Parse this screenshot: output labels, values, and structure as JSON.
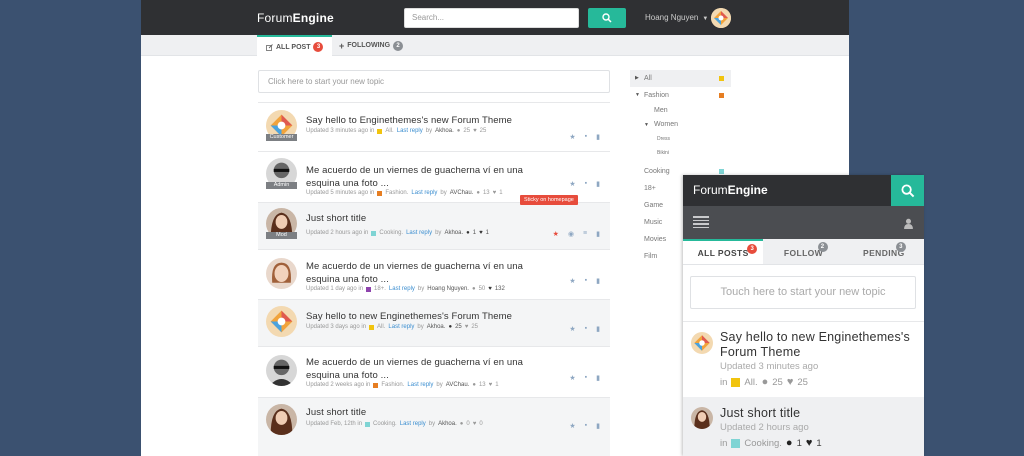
{
  "desktop": {
    "logo": {
      "a": "Forum",
      "b": "Engine"
    },
    "search_placeholder": "Search...",
    "user_name": "Hoang Nguyen",
    "tabs": [
      {
        "label": "ALL POST",
        "count": "3"
      },
      {
        "label": "FOLLOWING",
        "count": "2"
      }
    ],
    "new_topic_placeholder": "Click here to start your new topic",
    "tooltip": "Sticky on homepage",
    "threads": [
      {
        "title": "Say hello to Enginethemes's new Forum Theme",
        "role": "Customer",
        "updated": "Updated 3 minutes ago in",
        "category": "All.",
        "cat_color": "#f1c40f",
        "last_reply": "Last reply",
        "by": "by",
        "author": "Akhoa.",
        "comments": "25",
        "likes": "25"
      },
      {
        "title": "Me acuerdo de un viernes de guacherna ví en una esquina una foto ...",
        "role": "Admin",
        "updated": "Updated 5 minutes ago in",
        "category": "Fashion.",
        "cat_color": "#e67e22",
        "last_reply": "Last reply",
        "by": "by",
        "author": "AVChau.",
        "comments": "13",
        "likes": "1"
      },
      {
        "title": "Just short title",
        "role": "Mod",
        "updated": "Updated 2 hours ago in",
        "category": "Cooking.",
        "cat_color": "#7fd4d4",
        "last_reply": "Last reply",
        "by": "by",
        "author": "Akhoa.",
        "comments": "1",
        "likes": "1"
      },
      {
        "title": "Me acuerdo de un viernes de guacherna ví en una esquina una foto ...",
        "role": "",
        "updated": "Updated 1 day ago in",
        "category": "18+.",
        "cat_color": "#8e44ad",
        "last_reply": "Last reply",
        "by": "by",
        "author": "Hoang Nguyen.",
        "comments": "50",
        "likes": "132"
      },
      {
        "title": "Say hello to new Enginethemes's Forum Theme",
        "role": "",
        "updated": "Updated 3 days ago in",
        "category": "All.",
        "cat_color": "#f1c40f",
        "last_reply": "Last reply",
        "by": "by",
        "author": "Akhoa.",
        "comments": "25",
        "likes": "25"
      },
      {
        "title": "Me acuerdo de un viernes de guacherna ví en una esquina una foto ...",
        "role": "",
        "updated": "Updated 2 weeks ago in",
        "category": "Fashion.",
        "cat_color": "#e67e22",
        "last_reply": "Last reply",
        "by": "by",
        "author": "AVChau.",
        "comments": "13",
        "likes": "1"
      },
      {
        "title": "Just short title",
        "role": "",
        "updated": "Updated Feb, 12th in",
        "category": "Cooking.",
        "cat_color": "#7fd4d4",
        "last_reply": "Last reply",
        "by": "by",
        "author": "Akhoa.",
        "comments": "0",
        "likes": "0"
      }
    ],
    "categories": [
      {
        "label": "All",
        "color": "#f1c40f"
      },
      {
        "label": "Fashion",
        "color": "#e67e22"
      },
      {
        "label": "Men"
      },
      {
        "label": "Women"
      },
      {
        "label": "Dress"
      },
      {
        "label": "Bikini"
      },
      {
        "label": "Cooking",
        "color": "#7fd4d4"
      },
      {
        "label": "18+"
      },
      {
        "label": "Game"
      },
      {
        "label": "Music"
      },
      {
        "label": "Movies"
      },
      {
        "label": "Film"
      }
    ]
  },
  "mobile": {
    "logo": {
      "a": "Forum",
      "b": "Engine"
    },
    "tabs": [
      {
        "label": "ALL POSTS",
        "count": "3"
      },
      {
        "label": "FOLLOW",
        "count": "2"
      },
      {
        "label": "PENDING",
        "count": "3"
      }
    ],
    "new_topic_placeholder": "Touch here to start your new topic",
    "threads": [
      {
        "title": "Say hello to new Enginethemes's Forum Theme",
        "updated": "Updated 3 minutes ago",
        "in": "in",
        "category": "All.",
        "cat_color": "#f1c40f",
        "comments": "25",
        "likes": "25"
      },
      {
        "title": "Just short title",
        "updated": "Updated 2 hours ago",
        "in": "in",
        "category": "Cooking.",
        "cat_color": "#7fd4d4",
        "comments": "1",
        "likes": "1"
      }
    ]
  },
  "colors": {
    "accent": "#26b99a",
    "badge_red": "#e74c3c",
    "background": "#3b5170",
    "topbar": "#2f3033"
  }
}
